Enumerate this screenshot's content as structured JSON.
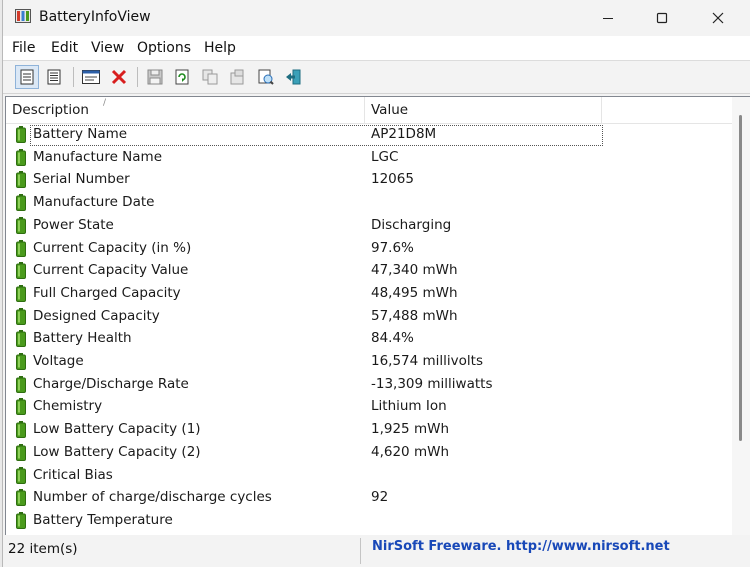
{
  "window": {
    "title": "BatteryInfoView"
  },
  "menu": [
    "File",
    "Edit",
    "View",
    "Options",
    "Help"
  ],
  "columns": {
    "description": "Description",
    "value": "Value"
  },
  "rows": [
    {
      "description": "Battery Name",
      "value": "AP21D8M"
    },
    {
      "description": "Manufacture Name",
      "value": "LGC"
    },
    {
      "description": "Serial Number",
      "value": "12065"
    },
    {
      "description": "Manufacture Date",
      "value": ""
    },
    {
      "description": "Power State",
      "value": "Discharging"
    },
    {
      "description": "Current Capacity (in %)",
      "value": "97.6%"
    },
    {
      "description": "Current Capacity Value",
      "value": "47,340 mWh"
    },
    {
      "description": "Full Charged Capacity",
      "value": "48,495 mWh"
    },
    {
      "description": "Designed Capacity",
      "value": "57,488 mWh"
    },
    {
      "description": "Battery Health",
      "value": "84.4%"
    },
    {
      "description": "Voltage",
      "value": "16,574 millivolts"
    },
    {
      "description": "Charge/Discharge Rate",
      "value": "-13,309 milliwatts"
    },
    {
      "description": "Chemistry",
      "value": "Lithium Ion"
    },
    {
      "description": "Low Battery Capacity (1)",
      "value": "1,925 mWh"
    },
    {
      "description": "Low Battery Capacity (2)",
      "value": "4,620 mWh"
    },
    {
      "description": "Critical Bias",
      "value": ""
    },
    {
      "description": "Number of charge/discharge cycles",
      "value": "92"
    },
    {
      "description": "Battery Temperature",
      "value": ""
    }
  ],
  "status": {
    "count": "22 item(s)",
    "link": "NirSoft Freeware.  http://www.nirsoft.net"
  },
  "colors": {
    "link": "#1848b8",
    "battery": "#4a9a1c",
    "selection_border": "#8fb3d9"
  },
  "icons": {
    "toolbar": [
      "battery-info-view-icon",
      "battery-log-view-icon",
      "properties-icon",
      "delete-icon",
      "save-icon",
      "refresh-icon",
      "copy-icon",
      "advanced-options-icon",
      "html-report-icon",
      "exit-icon"
    ],
    "row": "battery-icon"
  }
}
